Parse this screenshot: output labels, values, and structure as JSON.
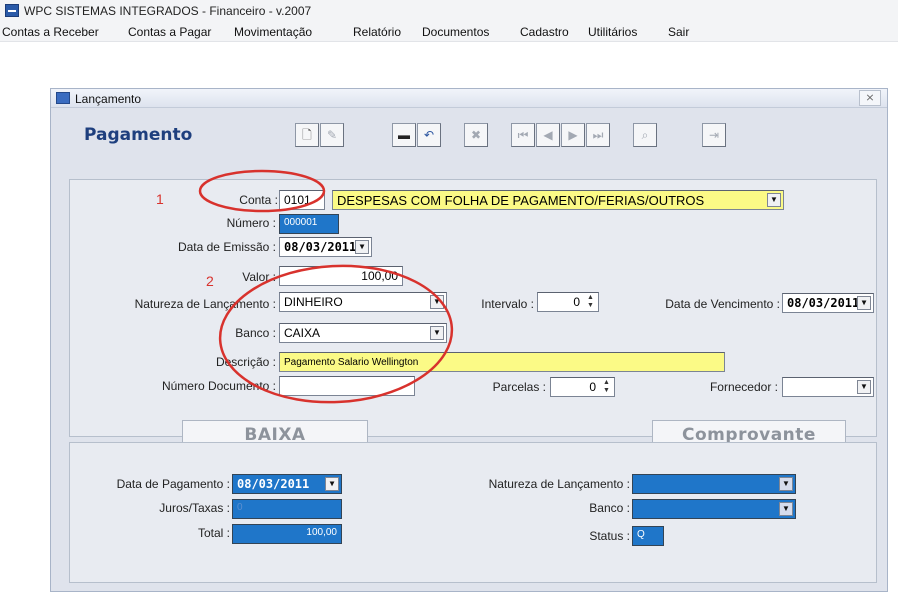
{
  "window": {
    "title": "WPC SISTEMAS INTEGRADOS - Financeiro - v.2007"
  },
  "menu": [
    "Contas a Receber",
    "Contas a Pagar",
    "Movimentação",
    "Relatório",
    "Documentos",
    "Cadastro",
    "Utilitários",
    "Sair"
  ],
  "dialog": {
    "title": "Lançamento",
    "heading": "Pagamento",
    "close": "⨯"
  },
  "toolbar": [
    {
      "name": "new-icon",
      "glyph": "🗋"
    },
    {
      "name": "edit-icon",
      "glyph": "✎"
    },
    {
      "name": "save-icon",
      "glyph": "▬"
    },
    {
      "name": "undo-icon",
      "glyph": "↶"
    },
    {
      "name": "delete-icon",
      "glyph": "✖"
    },
    {
      "name": "first-record-icon",
      "glyph": "⏮"
    },
    {
      "name": "prev-record-icon",
      "glyph": "◀"
    },
    {
      "name": "next-record-icon",
      "glyph": "▶"
    },
    {
      "name": "last-record-icon",
      "glyph": "⏭"
    },
    {
      "name": "search-icon",
      "glyph": "⌕"
    },
    {
      "name": "exit-icon",
      "glyph": "⇥"
    }
  ],
  "annotations": {
    "mark1": "1",
    "mark2": "2"
  },
  "form": {
    "conta": {
      "label": "Conta :",
      "code": "0101",
      "name": "DESPESAS COM FOLHA DE PAGAMENTO/FERIAS/OUTROS"
    },
    "numero": {
      "label": "Número :",
      "value": "000001"
    },
    "data_emissao": {
      "label": "Data de Emissão :",
      "value": "08/03/2011"
    },
    "valor": {
      "label": "Valor :",
      "value": "100,00"
    },
    "natureza": {
      "label": "Natureza de Lançamento :",
      "value": "DINHEIRO"
    },
    "intervalo": {
      "label": "Intervalo :",
      "value": "0"
    },
    "data_vencimento": {
      "label": "Data de Vencimento :",
      "value": "08/03/2011"
    },
    "banco": {
      "label": "Banco :",
      "value": "CAIXA"
    },
    "descricao": {
      "label": "Descrição :",
      "value": "Pagamento Salario Wellington"
    },
    "numero_documento": {
      "label": "Número Documento :",
      "value": ""
    },
    "parcelas": {
      "label": "Parcelas :",
      "value": "0"
    },
    "fornecedor": {
      "label": "Fornecedor :",
      "value": ""
    }
  },
  "buttons": {
    "baixa": "BAIXA",
    "comprovante": "Comprovante"
  },
  "payment": {
    "data_pagamento": {
      "label": "Data de Pagamento :",
      "value": "08/03/2011"
    },
    "juros": {
      "label": "Juros/Taxas :",
      "value": "0"
    },
    "total": {
      "label": "Total :",
      "value": "100,00"
    },
    "natureza": {
      "label": "Natureza de Lançamento :",
      "value": ""
    },
    "banco": {
      "label": "Banco :",
      "value": ""
    },
    "status": {
      "label": "Status :",
      "value": "Q"
    }
  },
  "colors": {
    "heading": "#1e3f7e",
    "highlight_yellow": "#fbfa86",
    "field_blue": "#1f76c9",
    "annotation_red": "#d8322d"
  }
}
